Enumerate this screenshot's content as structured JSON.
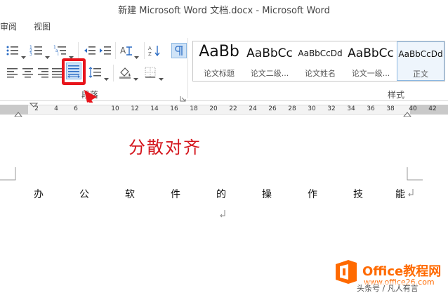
{
  "window": {
    "title": "新建 Microsoft Word 文档.docx - Microsoft Word"
  },
  "menu": {
    "tabs": [
      {
        "label": "审阅"
      },
      {
        "label": "视图"
      }
    ]
  },
  "ribbon": {
    "paragraph_group_label": "段落",
    "styles_group_label": "样式",
    "styles": [
      {
        "sample": "AaBb",
        "name": "论文标题"
      },
      {
        "sample": "AaBbCc",
        "name": "论文二级..."
      },
      {
        "sample": "AaBbCcDd",
        "name": "论文姓名"
      },
      {
        "sample": "AaBbCc",
        "name": "论文一级..."
      },
      {
        "sample": "AaBbCcDd",
        "name": "正文"
      }
    ]
  },
  "ruler": {
    "ticks": [
      "2",
      "4",
      "6",
      "10",
      "12",
      "14",
      "16",
      "18",
      "20",
      "22",
      "24",
      "26",
      "28",
      "30",
      "32",
      "34",
      "36",
      "38",
      "40",
      "42"
    ]
  },
  "document": {
    "annotation": "分散对齐",
    "characters": [
      "办",
      "公",
      "软",
      "件",
      "的",
      "操",
      "作",
      "技",
      "能"
    ]
  },
  "watermark": {
    "brand": "Office教程网",
    "url": "www.office26.com",
    "footer": "头条号 / 凡人有言"
  },
  "colors": {
    "highlight": "#e8141b",
    "annotation": "#d4141b",
    "brand": "#ff6a00",
    "ribbon_icon_blue": "#2b6cc4"
  },
  "icons": {
    "distributed_align": "distributed-align-icon",
    "numbering": "numbering-icon",
    "bullets": "bullets-icon"
  }
}
